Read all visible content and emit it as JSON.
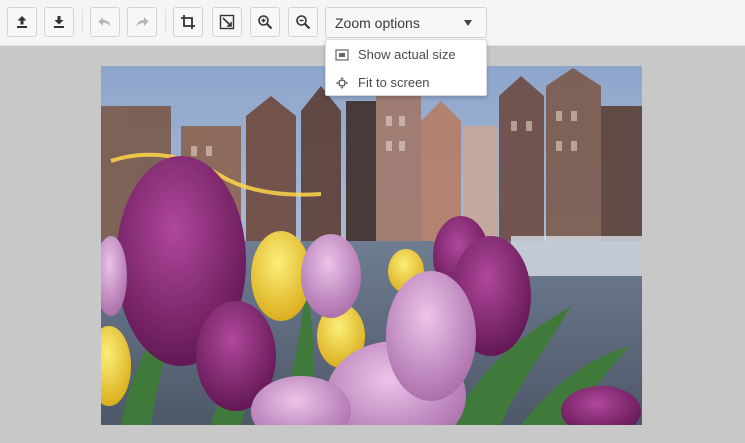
{
  "toolbar": {
    "buttons": [
      {
        "name": "upload-icon",
        "tooltip": ""
      },
      {
        "name": "download-icon",
        "tooltip": ""
      },
      {
        "name": "undo-icon",
        "disabled": true
      },
      {
        "name": "redo-icon",
        "disabled": true
      },
      {
        "name": "crop-icon"
      },
      {
        "name": "resize-icon"
      },
      {
        "name": "zoom-in-icon"
      },
      {
        "name": "zoom-out-icon"
      }
    ],
    "zoom_select": {
      "label": "Zoom options"
    }
  },
  "zoom_menu": {
    "items": [
      {
        "label": "Show actual size",
        "icon": "actual-size-icon"
      },
      {
        "label": "Fit to screen",
        "icon": "fit-to-screen-icon"
      }
    ]
  },
  "image": {
    "subject": "tulips-amsterdam-canal-houses",
    "colors": {
      "sky": "#9fb3d0",
      "tulip_purple": "#8c2a78",
      "tulip_pink": "#c98fc6",
      "tulip_yellow": "#f2d640",
      "stem_green": "#3f7a3a"
    }
  }
}
